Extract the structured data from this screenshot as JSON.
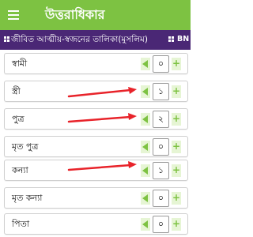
{
  "appbar": {
    "title": "উত্তরাধিকার",
    "menu_icon": "menu-icon"
  },
  "subbar": {
    "title": "জীবিত আত্মীয়-স্বজনের তালিকা(মুসলিম)",
    "lang": "BN",
    "icon": "grid-icon"
  },
  "relatives": [
    {
      "label": "স্বামী",
      "value": "০"
    },
    {
      "label": "স্ত্রী",
      "value": "১"
    },
    {
      "label": "পুত্র",
      "value": "২"
    },
    {
      "label": "মৃত পুত্র",
      "value": "০"
    },
    {
      "label": "কন্যা",
      "value": "১"
    },
    {
      "label": "মৃত কন্যা",
      "value": "০"
    },
    {
      "label": "পিতা",
      "value": "০"
    }
  ],
  "colors": {
    "appbar": "#7dc242",
    "subbar": "#4a2775",
    "annotation_arrow": "#e8232a"
  }
}
